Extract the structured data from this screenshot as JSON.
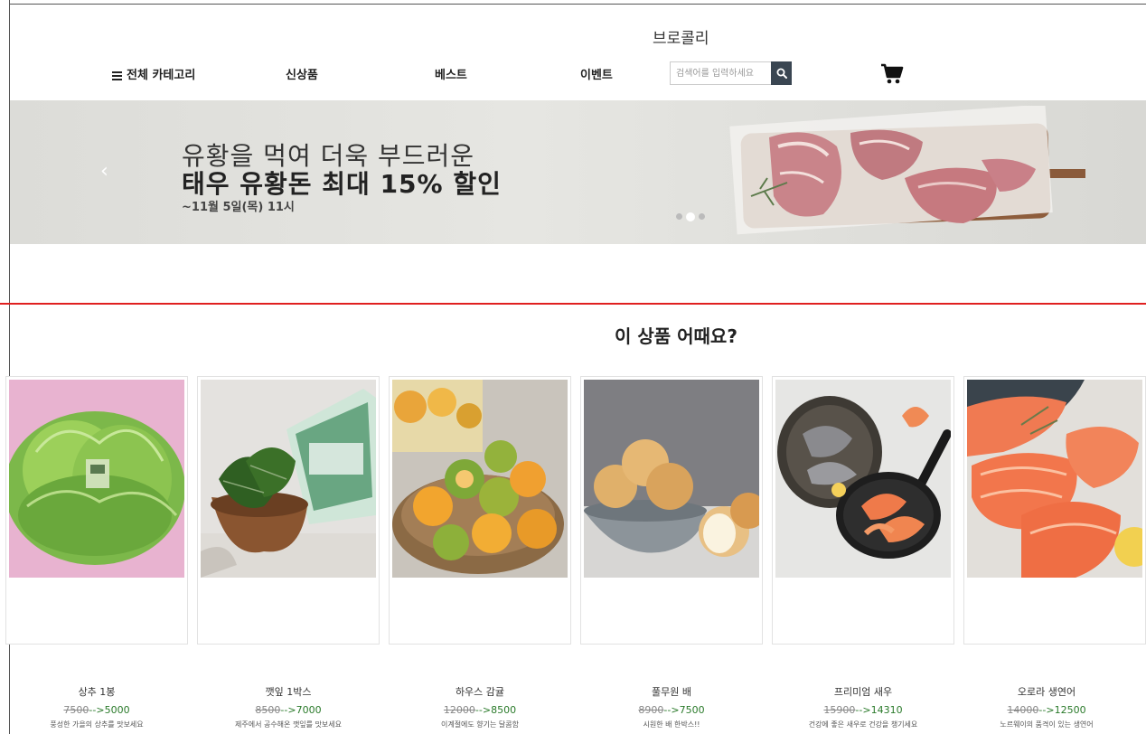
{
  "header": {
    "brand": "브로콜리",
    "nav": [
      "전체 카테고리",
      "신상품",
      "베스트",
      "이벤트"
    ],
    "search": {
      "placeholder": "검색어를 입력하세요"
    }
  },
  "banner": {
    "line1": "유황을 먹여 더욱 부드러운",
    "line2": "태우 유황돈 최대 15% 할인",
    "date": "~11월 5일(목) 11시",
    "prev": "‹",
    "active_slide": 2,
    "slide_count": 3
  },
  "recommend": {
    "title": "이 상품 어때요?",
    "products": [
      {
        "name": "상추 1봉",
        "old_price": "7500",
        "sep": "-->",
        "new_price": "5000",
        "desc": "풍성한 가을의 상추를 맛보세요"
      },
      {
        "name": "깻잎 1박스",
        "old_price": "8500",
        "sep": "-->",
        "new_price": "7000",
        "desc": "제주에서 공수해온 깻잎를 맛보세요"
      },
      {
        "name": "하우스 감귤",
        "old_price": "12000",
        "sep": "-->",
        "new_price": "8500",
        "desc": "이계절에도 향기는 달콤함"
      },
      {
        "name": "풀무원 배",
        "old_price": "8900",
        "sep": "-->",
        "new_price": "7500",
        "desc": "시원한 배 한박스!!"
      },
      {
        "name": "프리미엄 새우",
        "old_price": "15900",
        "sep": "-->",
        "new_price": "14310",
        "desc": "건강에 좋은 새우로 건강을 챙기세요"
      },
      {
        "name": "오로라 생연어",
        "old_price": "14000",
        "sep": "-->",
        "new_price": "12500",
        "desc": "노르웨이의 품격이 있는 생연어"
      }
    ]
  },
  "colors": {
    "accent_line": "#e02020",
    "search_button": "#3a4652",
    "price_new": "#2a7a2a"
  }
}
